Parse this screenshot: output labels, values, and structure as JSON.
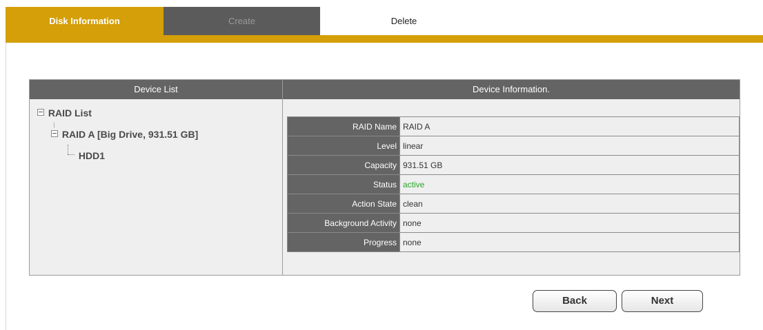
{
  "tabs": {
    "disk_information": "Disk Information",
    "create": "Create",
    "delete": "Delete"
  },
  "device_list": {
    "header": "Device List",
    "tree": {
      "root": "RAID List",
      "raid": "RAID A [Big Drive, 931.51 GB]",
      "disk": "HDD1"
    }
  },
  "device_info": {
    "header": "Device Information.",
    "rows": [
      {
        "label": "RAID Name",
        "value": "RAID A"
      },
      {
        "label": "Level",
        "value": "linear"
      },
      {
        "label": "Capacity",
        "value": "931.51 GB"
      },
      {
        "label": "Status",
        "value": "active"
      },
      {
        "label": "Action State",
        "value": "clean"
      },
      {
        "label": "Background Activity",
        "value": "none"
      },
      {
        "label": "Progress",
        "value": "none"
      }
    ]
  },
  "buttons": {
    "back": "Back",
    "next": "Next"
  },
  "colors": {
    "accent": "#d59f09",
    "header_gray": "#646464",
    "status_active": "#2aa52a"
  }
}
